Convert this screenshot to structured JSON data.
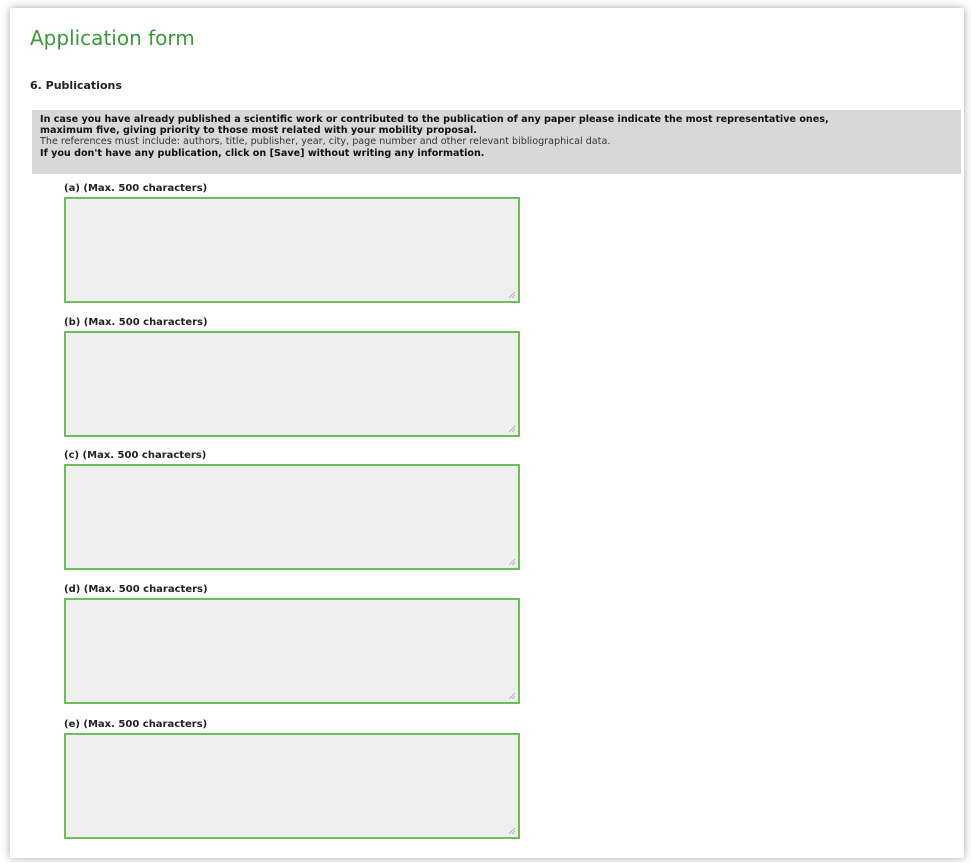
{
  "form": {
    "title": "Application form",
    "section_heading": "6. Publications",
    "instructions": {
      "line1": "In case you have already published a scientific work or contributed to the publication of any paper please indicate the most representative ones,",
      "line2": "maximum five, giving priority to those most related with your mobility proposal.",
      "line3": "The references must include: authors, title, publisher, year, city, page number and other relevant bibliographical data.",
      "line4": "If you don't have any publication, click on [Save] without writing any information."
    },
    "fields": [
      {
        "label": "(a) (Max. 500 characters)",
        "value": ""
      },
      {
        "label": "(b) (Max. 500 characters)",
        "value": ""
      },
      {
        "label": "(c) (Max. 500 characters)",
        "value": ""
      },
      {
        "label": "(d) (Max. 500 characters)",
        "value": ""
      },
      {
        "label": "(e) (Max. 500 characters)",
        "value": ""
      }
    ]
  },
  "colors": {
    "title": "#3a9a3a",
    "field_border": "#6cbf5a",
    "field_background": "#efefef",
    "info_background": "#d8d8d8"
  },
  "icons": {
    "resize_grip": "resize-grip-icon"
  }
}
